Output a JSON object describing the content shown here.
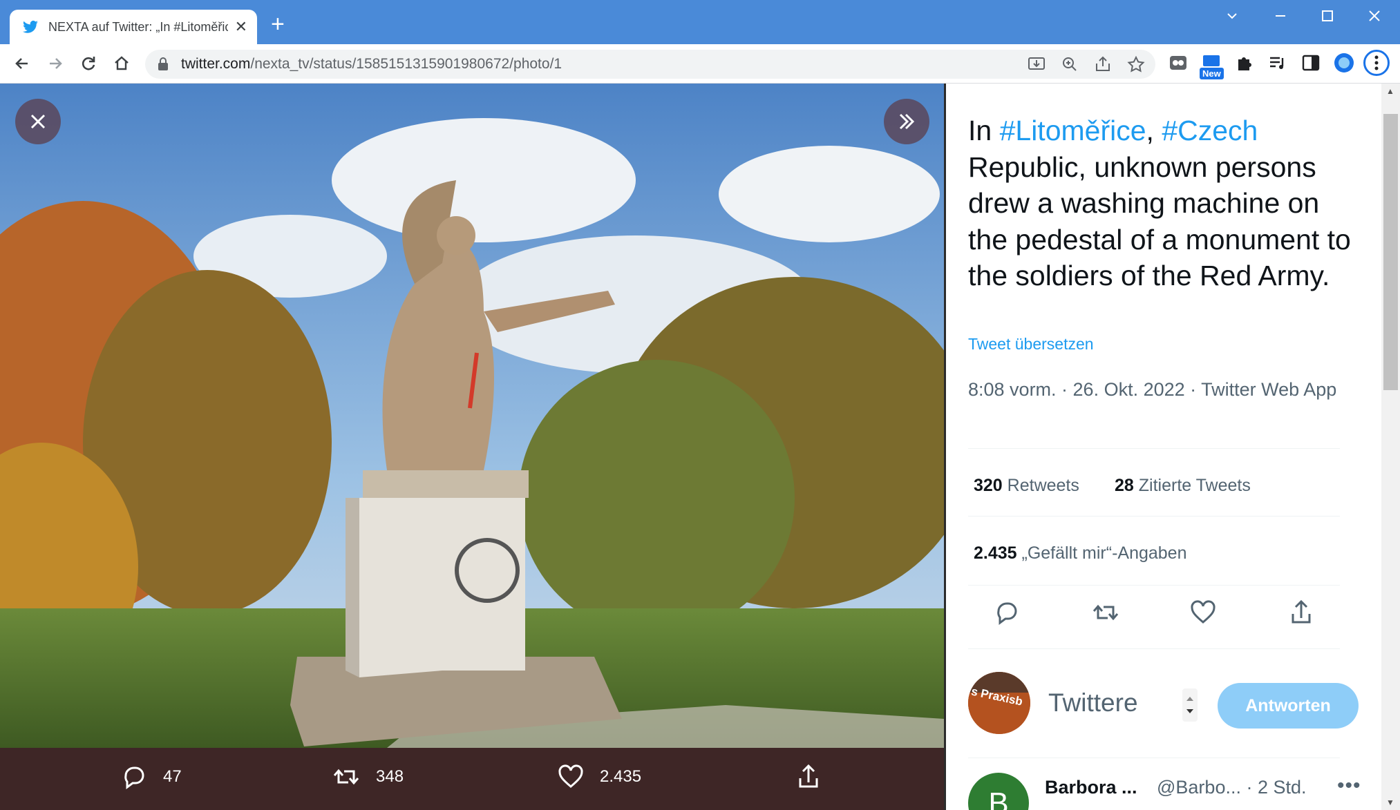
{
  "browser": {
    "tab_title": "NEXTA auf Twitter: „In #Litoměřic",
    "url_host": "twitter.com",
    "url_path": "/nexta_tv/status/1585151315901980672/photo/1",
    "extension_badge": "New"
  },
  "media": {
    "reply_count": "47",
    "retweet_count": "348",
    "like_count": "2.435"
  },
  "tweet": {
    "text_prefix": "In ",
    "hashtag1": "#Litoměřice",
    "text_mid": ", ",
    "hashtag2": "#Czech",
    "text_rest": " Republic, unknown persons drew a washing machine on the pedestal of a monument to the soldiers of the Red Army.",
    "translate_link": "Tweet übersetzen",
    "meta": "8:08 vorm. · 26. Okt. 2022 · Twitter Web App",
    "retweets_num": "320",
    "retweets_label": " Retweets",
    "quotes_num": "28",
    "quotes_label": " Zitierte Tweets",
    "likes_num": "2.435",
    "likes_label": " „Gefällt mir“-Angaben"
  },
  "compose": {
    "placeholder": "Twittere",
    "reply_button": "Antworten",
    "avatar_text": "s Praxisb"
  },
  "first_reply": {
    "avatar_letter": "B",
    "name": "Barbora ...",
    "handle": "@Barbo... · 2 Std."
  },
  "colors": {
    "accent": "#1d9bf0",
    "tabbar": "#4a8ad8",
    "action_bar": "#3e2626"
  }
}
